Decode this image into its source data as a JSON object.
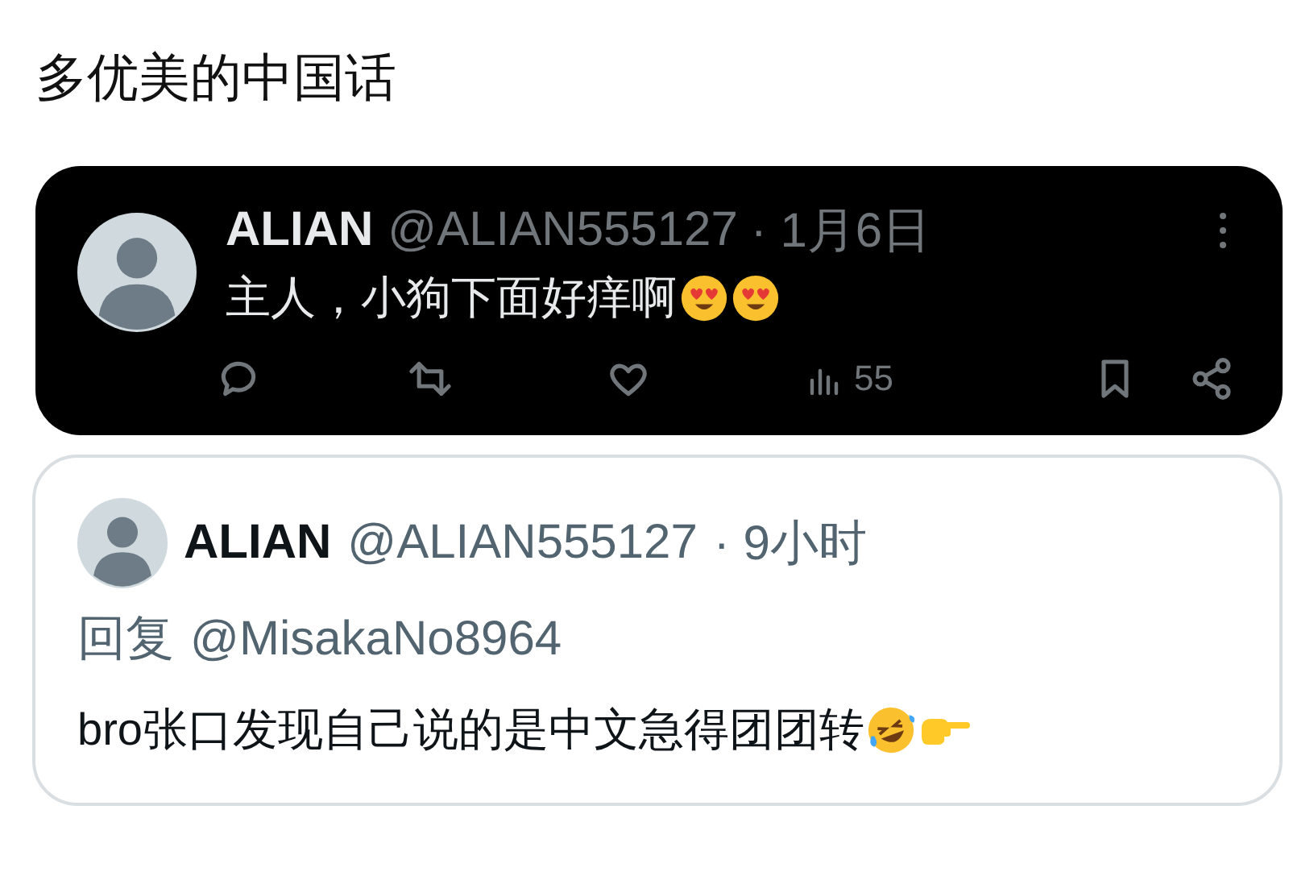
{
  "title": "多优美的中国话",
  "quoted_tweet": {
    "name": "ALIAN",
    "handle": "@ALIAN555127",
    "time": "· 1月6日",
    "text": "主人，小狗下面好痒啊",
    "emojis": [
      {
        "kind": "heart-eyes"
      },
      {
        "kind": "heart-eyes"
      }
    ],
    "views": "55"
  },
  "reply_tweet": {
    "name": "ALIAN",
    "handle": "@ALIAN555127",
    "time": "· 9小时",
    "reply_label": "回复",
    "reply_to": "@MisakaNo8964",
    "text": "bro张口发现自己说的是中文急得团团转",
    "emojis": [
      {
        "kind": "laughing"
      },
      {
        "kind": "pointing-hand"
      }
    ]
  }
}
